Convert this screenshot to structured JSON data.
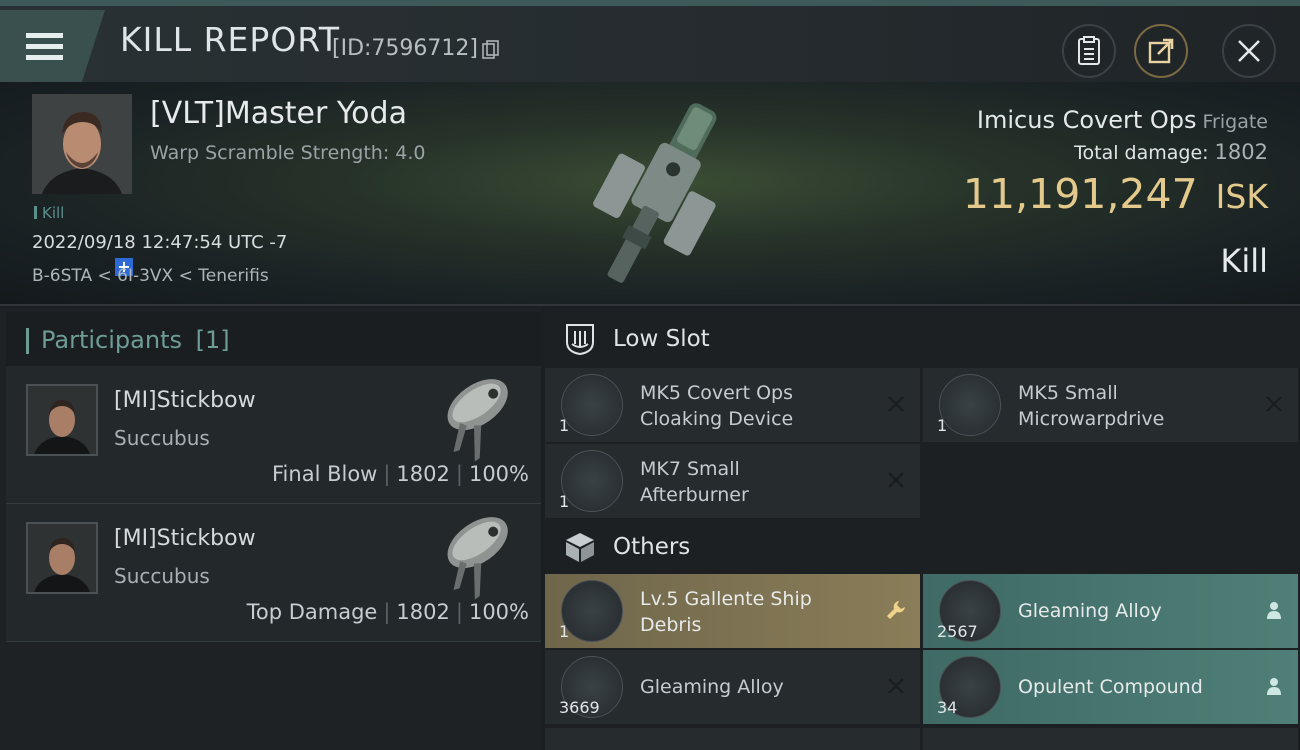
{
  "header": {
    "title": "KILL REPORT",
    "report_id": "[ID:7596712]"
  },
  "victim": {
    "name": "[VLT]Master Yoda",
    "warp_scramble": "Warp Scramble Strength: 4.0",
    "tag": "Kill",
    "datetime": "2022/09/18 12:47:54 UTC -7",
    "location": "B-6STA < 6I-3VX < Tenerifis",
    "ship_name": "Imicus Covert Ops",
    "ship_class": "Frigate",
    "total_damage_label": "Total damage:",
    "total_damage": "1802",
    "isk_value": "11,191,247",
    "isk_unit": "ISK",
    "result": "Kill"
  },
  "participants": {
    "label": "Participants",
    "count": "[1]",
    "rows": [
      {
        "name": "[MI]Stickbow",
        "ship": "Succubus",
        "role": "Final Blow",
        "damage": "1802",
        "percent": "100%"
      },
      {
        "name": "[MI]Stickbow",
        "ship": "Succubus",
        "role": "Top Damage",
        "damage": "1802",
        "percent": "100%"
      }
    ]
  },
  "sections": {
    "low_slot": "Low Slot",
    "others": "Others"
  },
  "items": {
    "low_slot": [
      {
        "name": "MK5 Covert Ops Cloaking Device",
        "line1": "MK5 Covert Ops",
        "line2": "Cloaking Device",
        "qty": "1",
        "status": "destroyed"
      },
      {
        "name": "MK5 Small Microwarpdrive",
        "line1": "MK5 Small",
        "line2": "Microwarpdrive",
        "qty": "1",
        "status": "destroyed"
      },
      {
        "name": "MK7 Small Afterburner",
        "line1": "MK7 Small",
        "line2": "Afterburner",
        "qty": "1",
        "status": "destroyed"
      }
    ],
    "others": [
      {
        "line1": "Lv.5 Gallente Ship",
        "line2": "Debris",
        "qty": "1",
        "status": "wrench"
      },
      {
        "line1": "Gleaming Alloy",
        "qty": "2567",
        "status": "dropped"
      },
      {
        "line1": "Gleaming Alloy",
        "qty": "3669",
        "status": "destroyed"
      },
      {
        "line1": "Opulent Compound",
        "qty": "34",
        "status": "dropped"
      }
    ]
  },
  "colors": {
    "accent_teal": "#4f7f78",
    "accent_gold": "#8a7d58",
    "isk_gold": "#e3c98c"
  }
}
